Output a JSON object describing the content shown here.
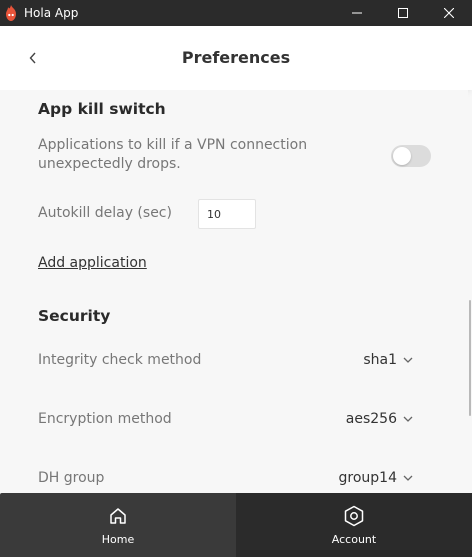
{
  "window": {
    "title": "Hola App"
  },
  "header": {
    "title": "Preferences"
  },
  "kill_switch": {
    "title": "App kill switch",
    "description": "Applications to kill if a VPN connection unexpectedly drops.",
    "toggle_on": false,
    "autokill_label": "Autokill delay (sec)",
    "autokill_value": "10",
    "add_application": "Add application"
  },
  "security": {
    "title": "Security",
    "integrity_label": "Integrity check method",
    "integrity_value": "sha1",
    "encryption_label": "Encryption method",
    "encryption_value": "aes256",
    "dh_label": "DH group",
    "dh_value": "group14"
  },
  "tabs": [
    {
      "label": "Home",
      "icon": "home-icon"
    },
    {
      "label": "Account",
      "icon": "account-icon"
    }
  ],
  "colors": {
    "titlebar": "#2b2b2b",
    "tabbar": "#2b2b2b",
    "logo": "#e8543a",
    "accent_text": "#333333"
  }
}
